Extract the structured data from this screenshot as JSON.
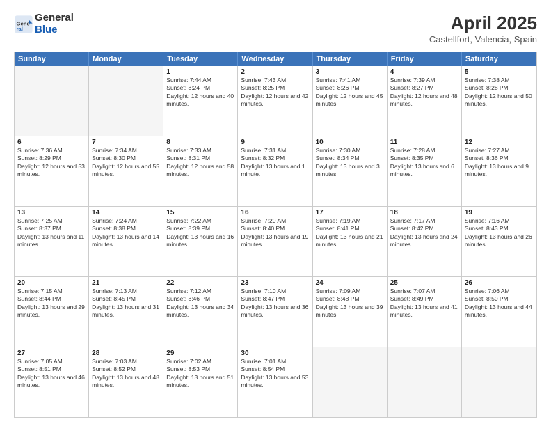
{
  "logo": {
    "general": "General",
    "blue": "Blue"
  },
  "title": "April 2025",
  "location": "Castellfort, Valencia, Spain",
  "header_days": [
    "Sunday",
    "Monday",
    "Tuesday",
    "Wednesday",
    "Thursday",
    "Friday",
    "Saturday"
  ],
  "weeks": [
    [
      {
        "day": "",
        "sunrise": "",
        "sunset": "",
        "daylight": "",
        "empty": true
      },
      {
        "day": "",
        "sunrise": "",
        "sunset": "",
        "daylight": "",
        "empty": true
      },
      {
        "day": "1",
        "sunrise": "Sunrise: 7:44 AM",
        "sunset": "Sunset: 8:24 PM",
        "daylight": "Daylight: 12 hours and 40 minutes.",
        "empty": false
      },
      {
        "day": "2",
        "sunrise": "Sunrise: 7:43 AM",
        "sunset": "Sunset: 8:25 PM",
        "daylight": "Daylight: 12 hours and 42 minutes.",
        "empty": false
      },
      {
        "day": "3",
        "sunrise": "Sunrise: 7:41 AM",
        "sunset": "Sunset: 8:26 PM",
        "daylight": "Daylight: 12 hours and 45 minutes.",
        "empty": false
      },
      {
        "day": "4",
        "sunrise": "Sunrise: 7:39 AM",
        "sunset": "Sunset: 8:27 PM",
        "daylight": "Daylight: 12 hours and 48 minutes.",
        "empty": false
      },
      {
        "day": "5",
        "sunrise": "Sunrise: 7:38 AM",
        "sunset": "Sunset: 8:28 PM",
        "daylight": "Daylight: 12 hours and 50 minutes.",
        "empty": false
      }
    ],
    [
      {
        "day": "6",
        "sunrise": "Sunrise: 7:36 AM",
        "sunset": "Sunset: 8:29 PM",
        "daylight": "Daylight: 12 hours and 53 minutes.",
        "empty": false
      },
      {
        "day": "7",
        "sunrise": "Sunrise: 7:34 AM",
        "sunset": "Sunset: 8:30 PM",
        "daylight": "Daylight: 12 hours and 55 minutes.",
        "empty": false
      },
      {
        "day": "8",
        "sunrise": "Sunrise: 7:33 AM",
        "sunset": "Sunset: 8:31 PM",
        "daylight": "Daylight: 12 hours and 58 minutes.",
        "empty": false
      },
      {
        "day": "9",
        "sunrise": "Sunrise: 7:31 AM",
        "sunset": "Sunset: 8:32 PM",
        "daylight": "Daylight: 13 hours and 1 minute.",
        "empty": false
      },
      {
        "day": "10",
        "sunrise": "Sunrise: 7:30 AM",
        "sunset": "Sunset: 8:34 PM",
        "daylight": "Daylight: 13 hours and 3 minutes.",
        "empty": false
      },
      {
        "day": "11",
        "sunrise": "Sunrise: 7:28 AM",
        "sunset": "Sunset: 8:35 PM",
        "daylight": "Daylight: 13 hours and 6 minutes.",
        "empty": false
      },
      {
        "day": "12",
        "sunrise": "Sunrise: 7:27 AM",
        "sunset": "Sunset: 8:36 PM",
        "daylight": "Daylight: 13 hours and 9 minutes.",
        "empty": false
      }
    ],
    [
      {
        "day": "13",
        "sunrise": "Sunrise: 7:25 AM",
        "sunset": "Sunset: 8:37 PM",
        "daylight": "Daylight: 13 hours and 11 minutes.",
        "empty": false
      },
      {
        "day": "14",
        "sunrise": "Sunrise: 7:24 AM",
        "sunset": "Sunset: 8:38 PM",
        "daylight": "Daylight: 13 hours and 14 minutes.",
        "empty": false
      },
      {
        "day": "15",
        "sunrise": "Sunrise: 7:22 AM",
        "sunset": "Sunset: 8:39 PM",
        "daylight": "Daylight: 13 hours and 16 minutes.",
        "empty": false
      },
      {
        "day": "16",
        "sunrise": "Sunrise: 7:20 AM",
        "sunset": "Sunset: 8:40 PM",
        "daylight": "Daylight: 13 hours and 19 minutes.",
        "empty": false
      },
      {
        "day": "17",
        "sunrise": "Sunrise: 7:19 AM",
        "sunset": "Sunset: 8:41 PM",
        "daylight": "Daylight: 13 hours and 21 minutes.",
        "empty": false
      },
      {
        "day": "18",
        "sunrise": "Sunrise: 7:17 AM",
        "sunset": "Sunset: 8:42 PM",
        "daylight": "Daylight: 13 hours and 24 minutes.",
        "empty": false
      },
      {
        "day": "19",
        "sunrise": "Sunrise: 7:16 AM",
        "sunset": "Sunset: 8:43 PM",
        "daylight": "Daylight: 13 hours and 26 minutes.",
        "empty": false
      }
    ],
    [
      {
        "day": "20",
        "sunrise": "Sunrise: 7:15 AM",
        "sunset": "Sunset: 8:44 PM",
        "daylight": "Daylight: 13 hours and 29 minutes.",
        "empty": false
      },
      {
        "day": "21",
        "sunrise": "Sunrise: 7:13 AM",
        "sunset": "Sunset: 8:45 PM",
        "daylight": "Daylight: 13 hours and 31 minutes.",
        "empty": false
      },
      {
        "day": "22",
        "sunrise": "Sunrise: 7:12 AM",
        "sunset": "Sunset: 8:46 PM",
        "daylight": "Daylight: 13 hours and 34 minutes.",
        "empty": false
      },
      {
        "day": "23",
        "sunrise": "Sunrise: 7:10 AM",
        "sunset": "Sunset: 8:47 PM",
        "daylight": "Daylight: 13 hours and 36 minutes.",
        "empty": false
      },
      {
        "day": "24",
        "sunrise": "Sunrise: 7:09 AM",
        "sunset": "Sunset: 8:48 PM",
        "daylight": "Daylight: 13 hours and 39 minutes.",
        "empty": false
      },
      {
        "day": "25",
        "sunrise": "Sunrise: 7:07 AM",
        "sunset": "Sunset: 8:49 PM",
        "daylight": "Daylight: 13 hours and 41 minutes.",
        "empty": false
      },
      {
        "day": "26",
        "sunrise": "Sunrise: 7:06 AM",
        "sunset": "Sunset: 8:50 PM",
        "daylight": "Daylight: 13 hours and 44 minutes.",
        "empty": false
      }
    ],
    [
      {
        "day": "27",
        "sunrise": "Sunrise: 7:05 AM",
        "sunset": "Sunset: 8:51 PM",
        "daylight": "Daylight: 13 hours and 46 minutes.",
        "empty": false
      },
      {
        "day": "28",
        "sunrise": "Sunrise: 7:03 AM",
        "sunset": "Sunset: 8:52 PM",
        "daylight": "Daylight: 13 hours and 48 minutes.",
        "empty": false
      },
      {
        "day": "29",
        "sunrise": "Sunrise: 7:02 AM",
        "sunset": "Sunset: 8:53 PM",
        "daylight": "Daylight: 13 hours and 51 minutes.",
        "empty": false
      },
      {
        "day": "30",
        "sunrise": "Sunrise: 7:01 AM",
        "sunset": "Sunset: 8:54 PM",
        "daylight": "Daylight: 13 hours and 53 minutes.",
        "empty": false
      },
      {
        "day": "",
        "sunrise": "",
        "sunset": "",
        "daylight": "",
        "empty": true
      },
      {
        "day": "",
        "sunrise": "",
        "sunset": "",
        "daylight": "",
        "empty": true
      },
      {
        "day": "",
        "sunrise": "",
        "sunset": "",
        "daylight": "",
        "empty": true
      }
    ]
  ]
}
